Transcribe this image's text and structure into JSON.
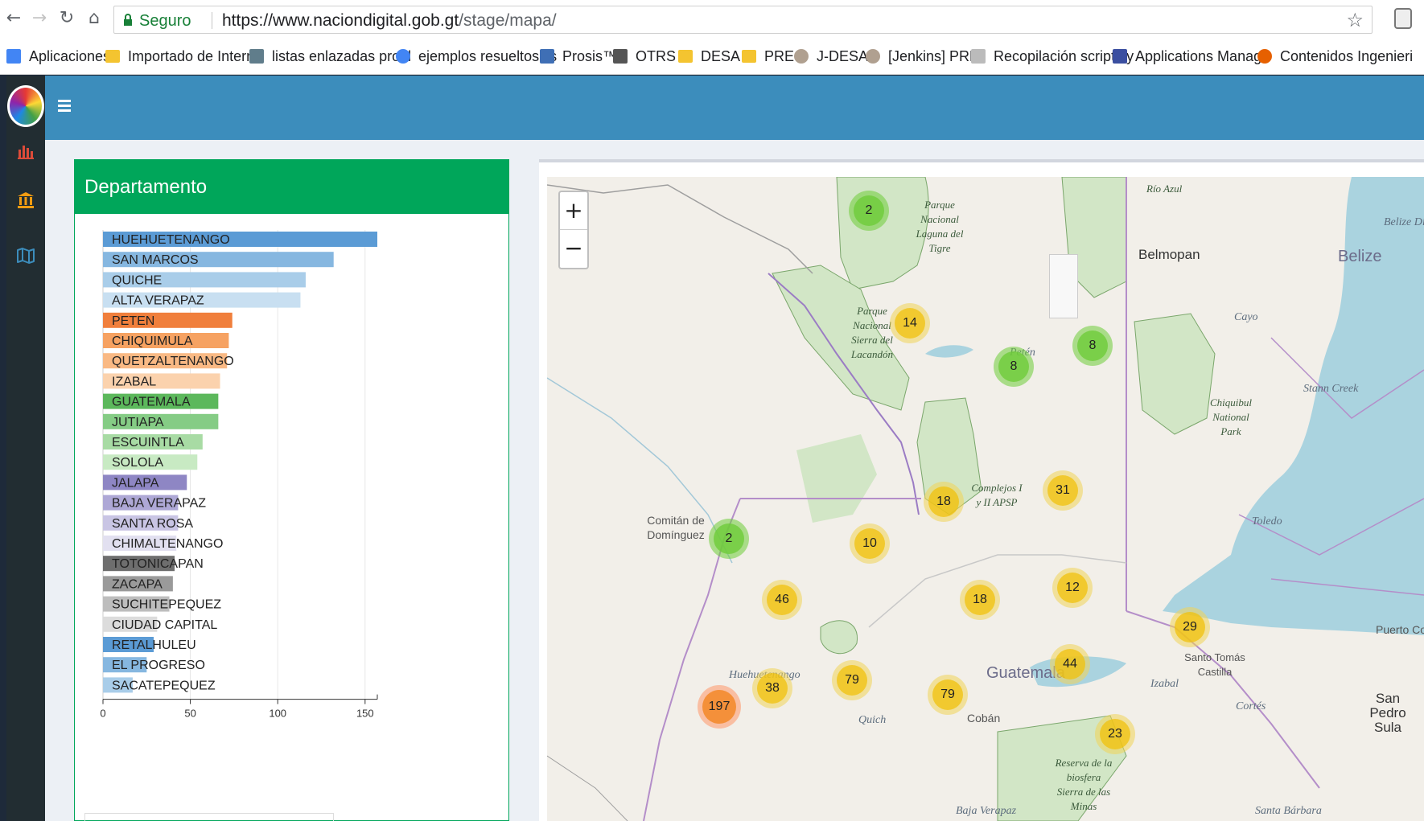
{
  "browser": {
    "secure_label": "Seguro",
    "url_host": "https://www.naciondigital.gob.gt",
    "url_path": "/stage/mapa/",
    "bookmarks": [
      {
        "label": "Aplicaciones",
        "icon": "apps-grid-icon"
      },
      {
        "label": "Importado de Interne",
        "icon": "folder-icon"
      },
      {
        "label": "listas enlazadas probl",
        "icon": "tool-icon"
      },
      {
        "label": "ejemplos resueltos lis",
        "icon": "google-icon"
      },
      {
        "label": "Prosis™",
        "icon": "prosis-icon"
      },
      {
        "label": "OTRS",
        "icon": "otrs-icon"
      },
      {
        "label": "DESA",
        "icon": "folder-icon"
      },
      {
        "label": "PRE",
        "icon": "folder-icon"
      },
      {
        "label": "J-DESA",
        "icon": "jenkins-icon"
      },
      {
        "label": "[Jenkins] PRE",
        "icon": "jenkins-icon"
      },
      {
        "label": "Recopilación scripts y",
        "icon": "script-icon"
      },
      {
        "label": "Applications Manage",
        "icon": "app-manager-icon"
      },
      {
        "label": "Contenidos Ingenieri",
        "icon": "firefox-icon"
      }
    ]
  },
  "panel": {
    "title": "Departamento"
  },
  "chart_data": {
    "type": "bar",
    "orientation": "horizontal",
    "categories": [
      "HUEHUETENANGO",
      "SAN MARCOS",
      "QUICHE",
      "ALTA VERAPAZ",
      "PETEN",
      "CHIQUIMULA",
      "QUETZALTENANGO",
      "IZABAL",
      "GUATEMALA",
      "JUTIAPA",
      "ESCUINTLA",
      "SOLOLA",
      "JALAPA",
      "BAJA VERAPAZ",
      "SANTA ROSA",
      "CHIMALTENANGO",
      "TOTONICAPAN",
      "ZACAPA",
      "SUCHITEPEQUEZ",
      "CIUDAD CAPITAL",
      "RETALHULEU",
      "EL PROGRESO",
      "SACATEPEQUEZ"
    ],
    "values": [
      157,
      132,
      116,
      113,
      74,
      72,
      71,
      67,
      66,
      66,
      57,
      54,
      48,
      43,
      43,
      42,
      41,
      40,
      38,
      31,
      29,
      25,
      17
    ],
    "colors": [
      "#5b9bd5",
      "#86b7e0",
      "#a9cde9",
      "#c8dff1",
      "#f07f3c",
      "#f6a262",
      "#f9b984",
      "#fbd2ad",
      "#5cb85c",
      "#85cc85",
      "#a8dba4",
      "#c8eac3",
      "#8e86c4",
      "#aea8d6",
      "#c9c5e4",
      "#e2e0f0",
      "#6e6e6e",
      "#9a9a9a",
      "#bdbdbd",
      "#dcdcdc",
      "#5b9bd5",
      "#86b7e0",
      "#a9cde9"
    ],
    "xticks": [
      0,
      50,
      100,
      150
    ],
    "xlim": [
      0,
      157
    ],
    "grid": true
  },
  "map": {
    "zoom_in": "+",
    "zoom_out": "−",
    "clusters": [
      {
        "label": "2",
        "color": "green"
      },
      {
        "label": "14",
        "color": "yellow"
      },
      {
        "label": "8",
        "color": "green"
      },
      {
        "label": "8",
        "color": "green"
      },
      {
        "label": "18",
        "color": "yellow"
      },
      {
        "label": "31",
        "color": "yellow"
      },
      {
        "label": "2",
        "color": "green"
      },
      {
        "label": "10",
        "color": "yellow"
      },
      {
        "label": "46",
        "color": "yellow"
      },
      {
        "label": "18",
        "color": "yellow"
      },
      {
        "label": "12",
        "color": "yellow"
      },
      {
        "label": "29",
        "color": "yellow"
      },
      {
        "label": "44",
        "color": "yellow"
      },
      {
        "label": "79",
        "color": "yellow"
      },
      {
        "label": "38",
        "color": "yellow"
      },
      {
        "label": "79",
        "color": "yellow"
      },
      {
        "label": "197",
        "color": "orange"
      },
      {
        "label": "23",
        "color": "yellow"
      }
    ],
    "labels": {
      "belmopan": "Belmopan",
      "belize": "Belize",
      "belize_district": "Belize Distr",
      "cayo": "Cayo",
      "stann_creek": "Stann Creek",
      "chiquibul": "Chiquibul National Park",
      "toledo": "Toledo",
      "peten": "Petén",
      "parque_laguna": "Parque Nacional Laguna del Tigre",
      "parque_lacandon": "Parque Nacional Sierra del Lacandón",
      "complejos": "Complejos I y II APSP",
      "rio_azul": "Río Azul",
      "comitan": "Comitán de Domínguez",
      "huehuetenango": "Huehuetenango",
      "guatemala": "Guatemala",
      "quiche": "Quich",
      "coban": "Cobán",
      "izabal": "Izabal",
      "santo_tomas": "Santo Tomás Castilla",
      "puerto_cortes": "Puerto Co",
      "cortes": "Cortés",
      "san_pedro": "San Pedro Sula",
      "sierra_minas": "Reserva de la biosfera Sierra de las Minas",
      "baja_verapaz": "Baja Verapaz",
      "santa_barbara": "Santa Bárbara"
    }
  }
}
